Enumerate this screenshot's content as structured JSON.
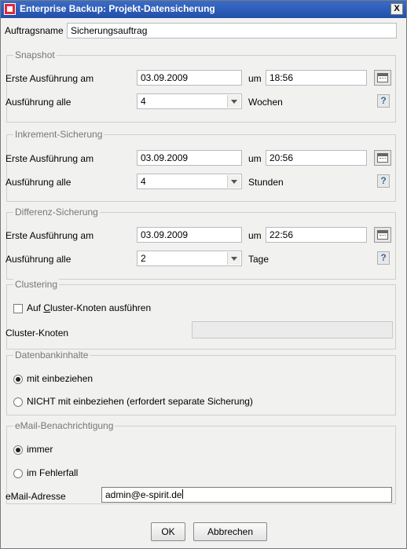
{
  "window": {
    "title": "Enterprise Backup: Projekt-Datensicherung",
    "close_glyph": "X"
  },
  "job_name": {
    "label": "Auftragsname",
    "value": "Sicherungsauftrag"
  },
  "snapshot": {
    "legend": "Snapshot",
    "first_run_label": "Erste Ausführung am",
    "date": "03.09.2009",
    "at_label": "um",
    "time": "18:56",
    "every_label": "Ausführung alle",
    "interval": "4",
    "unit": "Wochen",
    "help": "?"
  },
  "incremental": {
    "legend": "Inkrement-Sicherung",
    "first_run_label": "Erste Ausführung am",
    "date": "03.09.2009",
    "at_label": "um",
    "time": "20:56",
    "every_label": "Ausführung alle",
    "interval": "4",
    "unit": "Stunden",
    "help": "?"
  },
  "differential": {
    "legend": "Differenz-Sicherung",
    "first_run_label": "Erste Ausführung am",
    "date": "03.09.2009",
    "at_label": "um",
    "time": "22:56",
    "every_label": "Ausführung alle",
    "interval": "2",
    "unit": "Tage",
    "help": "?"
  },
  "clustering": {
    "legend": "Clustering",
    "checkbox_pre": "Auf ",
    "checkbox_underlined": "C",
    "checkbox_post": "luster-Knoten ausführen",
    "node_label": "Cluster-Knoten",
    "node_value": ""
  },
  "database": {
    "legend": "Datenbankinhalte",
    "option_include": "mit einbeziehen",
    "option_exclude": "NICHT mit einbeziehen (erfordert separate Sicherung)"
  },
  "email": {
    "legend": "eMail-Benachrichtigung",
    "option_always": "immer",
    "option_error": "im Fehlerfall",
    "address_label": "eMail-Adresse",
    "address_value": "admin@e-spirit.de"
  },
  "buttons": {
    "ok": "OK",
    "cancel": "Abbrechen"
  },
  "colors": {
    "titlebar": "#2a5cb8",
    "window_bg": "#f1f1ef",
    "legend_text": "#777777"
  }
}
